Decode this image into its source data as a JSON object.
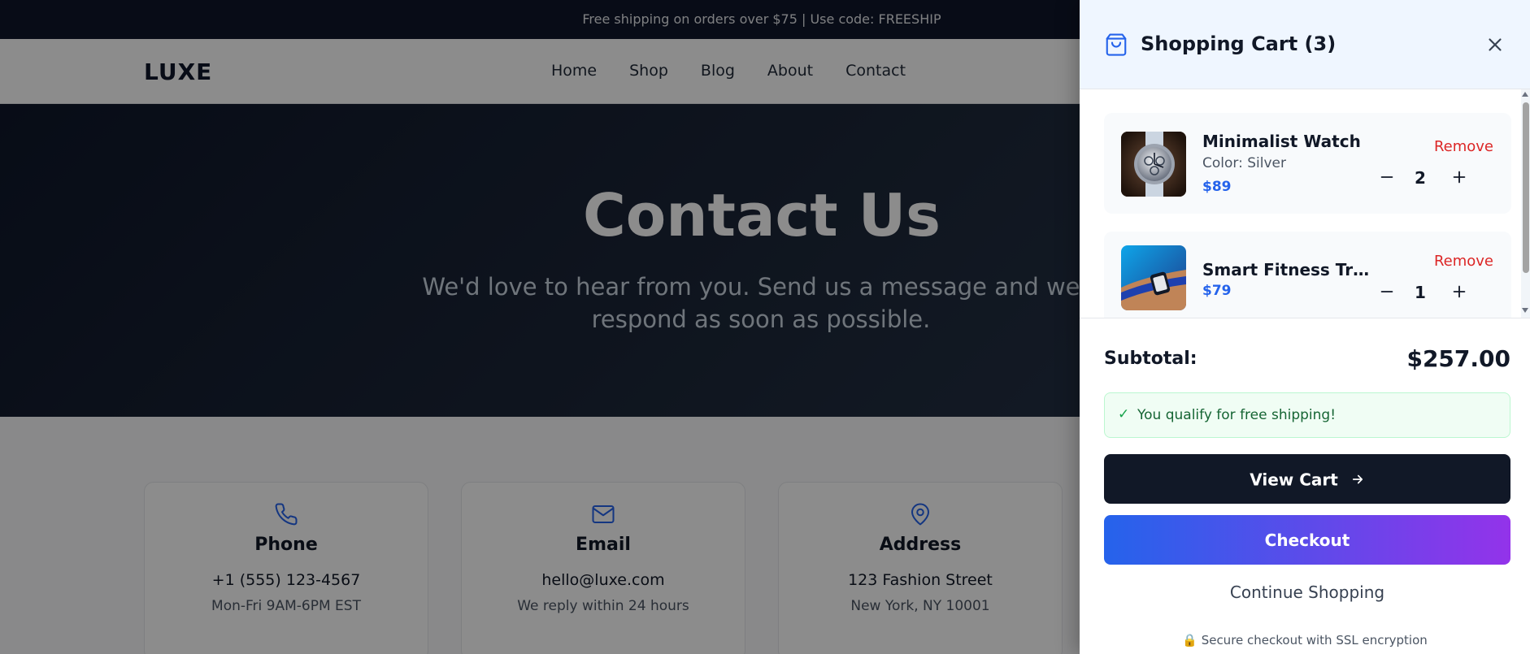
{
  "announcement": {
    "text": "Free shipping on orders over $75 | Use code: FREESHIP"
  },
  "header": {
    "logo": "LUXE",
    "nav": [
      "Home",
      "Shop",
      "Blog",
      "About",
      "Contact"
    ]
  },
  "hero": {
    "title": "Contact Us",
    "subtitle": "We'd love to hear from you. Send us a message and we'll respond as soon as possible."
  },
  "contact_cards": [
    {
      "icon": "phone-icon",
      "title": "Phone",
      "main": "+1 (555) 123-4567",
      "sub": "Mon-Fri 9AM-6PM EST"
    },
    {
      "icon": "mail-icon",
      "title": "Email",
      "main": "hello@luxe.com",
      "sub": "We reply within 24 hours"
    },
    {
      "icon": "map-pin-icon",
      "title": "Address",
      "main": "123 Fashion Street",
      "sub": "New York, NY 10001"
    }
  ],
  "cart": {
    "title": "Shopping Cart (3)",
    "items": [
      {
        "name": "Minimalist Watch",
        "color": "Color: Silver",
        "price": "$89",
        "quantity": "2",
        "remove_label": "Remove",
        "image": "silver-watch-image"
      },
      {
        "name": "Smart Fitness Tracker",
        "price": "$79",
        "quantity": "1",
        "remove_label": "Remove",
        "image": "fitness-tracker-image"
      }
    ],
    "subtotal_label": "Subtotal:",
    "subtotal_value": "$257.00",
    "shipping_check": "✓",
    "shipping_message": "You qualify for free shipping!",
    "view_cart_label": "View Cart",
    "checkout_label": "Checkout",
    "continue_label": "Continue Shopping",
    "secure_icon": "🔒",
    "secure_text": "Secure checkout with SSL encryption"
  },
  "colors": {
    "accent": "#2563eb",
    "remove": "#dc2626",
    "dark": "#111827",
    "checkout_gradient_start": "#2563eb",
    "checkout_gradient_end": "#9333ea"
  }
}
